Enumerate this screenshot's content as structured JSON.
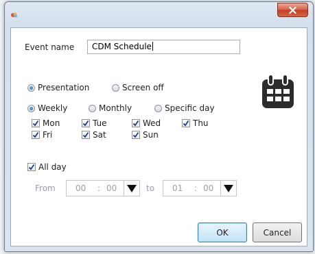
{
  "window": {
    "title": ""
  },
  "close_icon": "close-x-icon",
  "event": {
    "label": "Event name",
    "value": "CDM Schedule"
  },
  "mode": {
    "options": [
      {
        "label": "Presentation",
        "selected": true
      },
      {
        "label": "Screen off",
        "selected": false
      }
    ]
  },
  "calendar_icon": "calendar-icon",
  "frequency": {
    "options": [
      {
        "label": "Weekly",
        "selected": true
      },
      {
        "label": "Monthly",
        "selected": false
      },
      {
        "label": "Specific day",
        "selected": false
      }
    ]
  },
  "days": [
    {
      "label": "Mon",
      "checked": true
    },
    {
      "label": "Tue",
      "checked": true
    },
    {
      "label": "Wed",
      "checked": true
    },
    {
      "label": "Thu",
      "checked": true
    },
    {
      "label": "Fri",
      "checked": true
    },
    {
      "label": "Sat",
      "checked": true
    },
    {
      "label": "Sun",
      "checked": true
    }
  ],
  "all_day": {
    "label": "All day",
    "checked": true
  },
  "time": {
    "from_label": "From",
    "from_hour": "00",
    "from_sep": ":",
    "from_min": "00",
    "to_label": "to",
    "to_hour": "01",
    "to_sep": ":",
    "to_min": "00"
  },
  "buttons": {
    "ok": "OK",
    "cancel": "Cancel"
  },
  "colors": {
    "accent_radio": "#1b5fa6",
    "close_red": "#c23f22",
    "checkmark": "#1a3a8c"
  }
}
